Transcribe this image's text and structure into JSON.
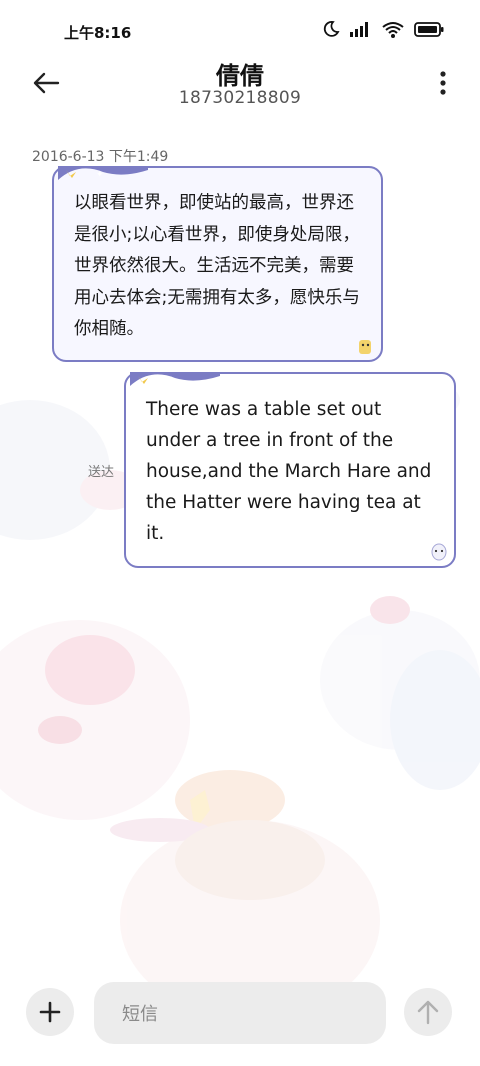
{
  "status_bar": {
    "time": "上午8:16",
    "icons": [
      "moon-icon",
      "cellular-signal-icon",
      "wifi-icon",
      "battery-icon"
    ]
  },
  "header": {
    "contact_name": "倩倩",
    "phone_number": "18730218809",
    "back_icon": "arrow-left-icon",
    "more_icon": "more-vertical-icon"
  },
  "conversation": {
    "timestamp": "2016-6-13 下午1:49",
    "messages": [
      {
        "direction": "incoming",
        "text": "以眼看世界，即使站的最高，世界还是很小;以心看世界，即使身处局限，世界依然很大。生活远不完美，需要用心去体会;无需拥有太多，愿快乐与你相随。"
      },
      {
        "direction": "outgoing",
        "text": "There was a table set out under a tree in front of the house,and the March Hare and the Hatter were having tea at it.",
        "status": "送达"
      }
    ]
  },
  "composer": {
    "placeholder": "短信",
    "add_icon": "plus-icon",
    "send_icon": "arrow-up-icon"
  },
  "colors": {
    "bubble_border": "#7b7cc4",
    "bubble_fill": "#f7f7ff",
    "button_bg": "#ececec"
  }
}
